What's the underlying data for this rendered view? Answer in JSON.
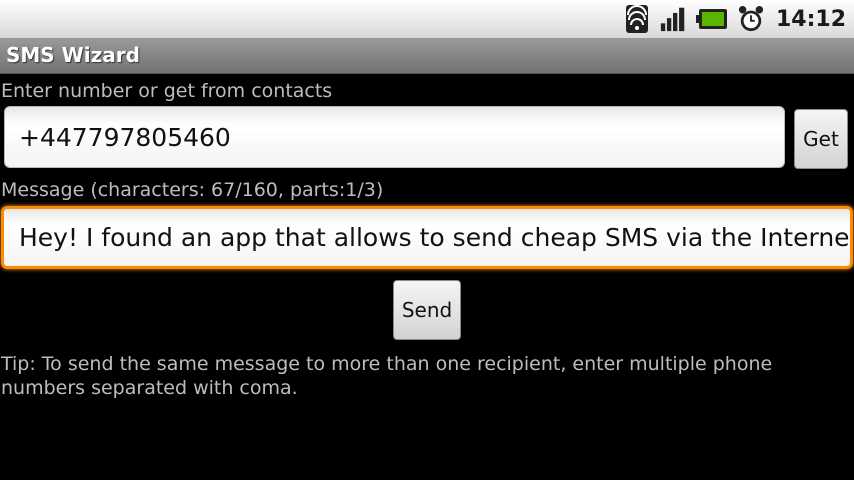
{
  "status_bar": {
    "icons": [
      "wifi-icon",
      "signal-icon",
      "battery-icon",
      "alarm-icon"
    ],
    "time": "14:12"
  },
  "app": {
    "title": "SMS Wizard"
  },
  "form": {
    "number_label": "Enter number or get from contacts",
    "number_value": "+447797805460",
    "get_label": "Get",
    "message_label": "Message (characters: 67/160, parts:1/3)",
    "message_value": "Hey! I found an app that allows to send cheap SMS via the Internet!",
    "send_label": "Send"
  },
  "tip": "Tip: To send the same message to more than one recipient, enter multiple phone numbers separated with coma.",
  "colors": {
    "focus_border": "#ff8a00",
    "battery": "#5ab400"
  }
}
